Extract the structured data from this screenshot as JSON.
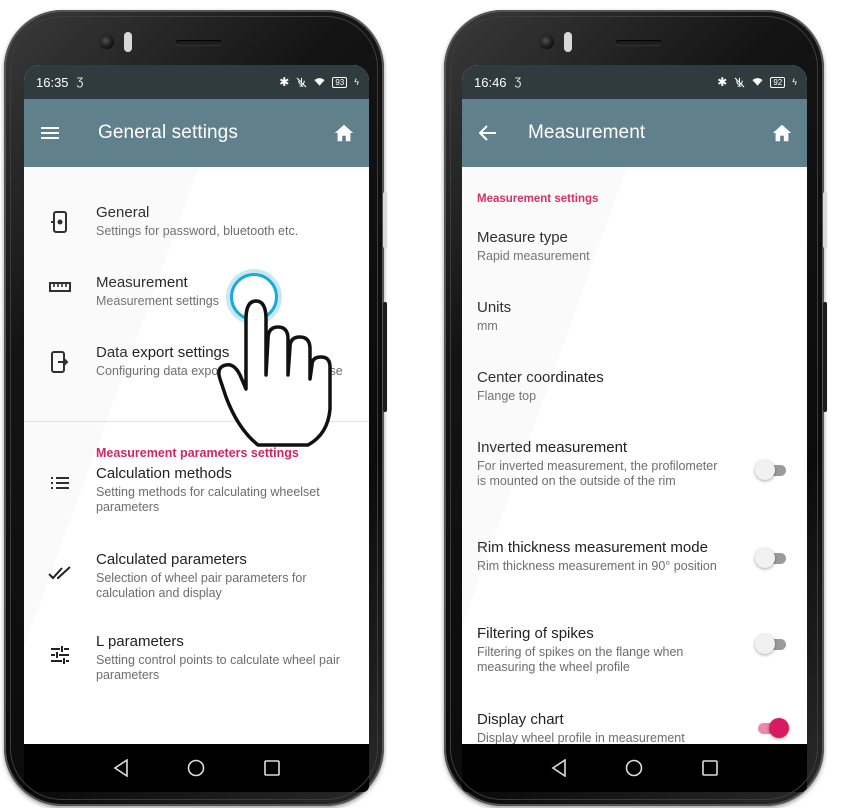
{
  "left_phone": {
    "status": {
      "time": "16:35",
      "sim": "Ʒ",
      "battery": "93"
    },
    "appbar": {
      "title": "General settings",
      "nav_icon": "menu-icon",
      "action_icon": "home-icon"
    },
    "items": [
      {
        "icon": "phone-settings-icon",
        "title": "General",
        "subtitle": "Settings for password, bluetooth etc."
      },
      {
        "icon": "ruler-icon",
        "title": "Measurement",
        "subtitle": "Measurement settings"
      },
      {
        "icon": "phone-export-icon",
        "title": "Data export settings",
        "subtitle": "Configuring data export to external database"
      }
    ],
    "section": "Measurement parameters settings",
    "params": [
      {
        "icon": "list-icon",
        "title": "Calculation methods",
        "subtitle": "Setting methods for calculating wheelset parameters"
      },
      {
        "icon": "double-check-icon",
        "title": "Calculated parameters",
        "subtitle": "Selection of wheel pair parameters for calculation and display"
      },
      {
        "icon": "tune-icon",
        "title": "L parameters",
        "subtitle": "Setting control points to calculate wheel pair parameters"
      }
    ]
  },
  "right_phone": {
    "status": {
      "time": "16:46",
      "sim": "Ʒ",
      "battery": "92"
    },
    "appbar": {
      "title": "Measurement",
      "nav_icon": "back-arrow-icon",
      "action_icon": "home-icon"
    },
    "section": "Measurement settings",
    "items": [
      {
        "title": "Measure type",
        "subtitle": "Rapid measurement"
      },
      {
        "title": "Units",
        "subtitle": "mm"
      },
      {
        "title": "Center coordinates",
        "subtitle": "Flange top"
      }
    ],
    "toggles": [
      {
        "title": "Inverted measurement",
        "subtitle": "For inverted measurement, the profilometer is mounted on the outside of the rim",
        "on": false
      },
      {
        "title": "Rim thickness measurement mode",
        "subtitle": "Rim thickness measurement in 90° position",
        "on": false
      },
      {
        "title": "Filtering of spikes",
        "subtitle": "Filtering of spikes on the flange when measuring the wheel profile",
        "on": false
      },
      {
        "title": "Display chart",
        "subtitle": "Display wheel profile in measurement",
        "on": true
      }
    ]
  },
  "colors": {
    "statusbar": "#2f3b3f",
    "appbar": "#60808c",
    "accent": "#d81b60",
    "tap": "#1aa9d8"
  }
}
